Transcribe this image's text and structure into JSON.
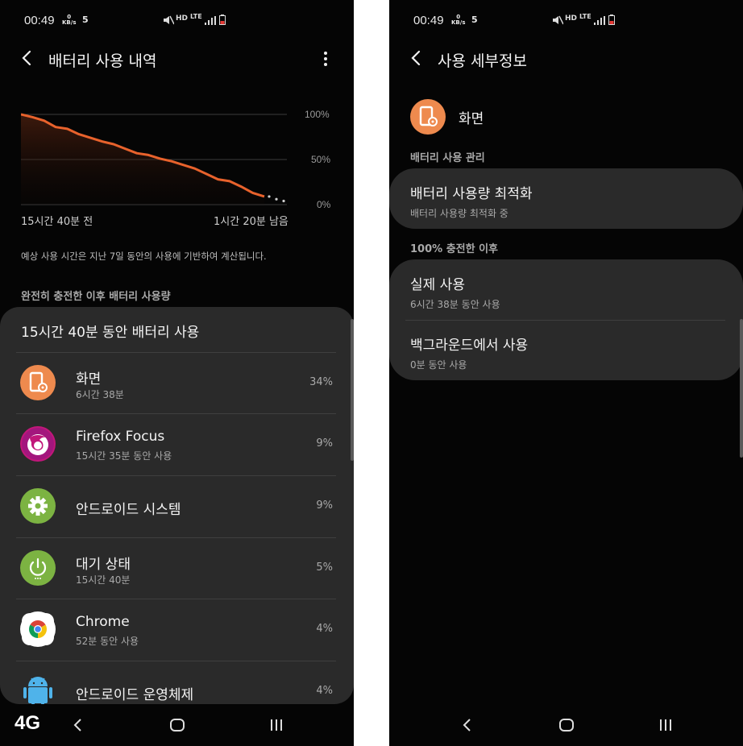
{
  "left": {
    "status": {
      "time": "00:49",
      "kbs_value": "0",
      "kbs_unit": "KB/s",
      "notif_count": "5",
      "hd": "HD",
      "lte": "LTE"
    },
    "title": "배터리 사용 내역",
    "chart_data": {
      "type": "area",
      "y_ticks": [
        "100%",
        "50%",
        "0%"
      ],
      "x_labels": [
        "15시간 40분 전",
        "1시간 20분 남음"
      ],
      "ylim": [
        0,
        100
      ],
      "series": [
        {
          "values": [
            100,
            97,
            93,
            86,
            84,
            78,
            74,
            70,
            67,
            62,
            57,
            55,
            51,
            48,
            44,
            40,
            34,
            28,
            26,
            20,
            13,
            9
          ]
        }
      ],
      "projection": [
        9,
        6,
        4
      ]
    },
    "note": "예상 사용 시간은 지난 7일 동안의 사용에 기반하여 계산됩니다.",
    "section": "완전히 충전한 이후 배터리 사용량",
    "card_title": "15시간 40분 동안 배터리 사용",
    "apps": [
      {
        "name": "화면",
        "sub": "6시간 38분",
        "pct": "34%",
        "icon": "screen-icon"
      },
      {
        "name": "Firefox Focus",
        "sub": "15시간 35분 동안 사용",
        "pct": "9%",
        "icon": "firefox-focus-icon"
      },
      {
        "name": "안드로이드 시스템",
        "sub": "",
        "pct": "9%",
        "icon": "gear-icon"
      },
      {
        "name": "대기 상태",
        "sub": "15시간 40분",
        "pct": "5%",
        "icon": "power-icon"
      },
      {
        "name": "Chrome",
        "sub": "52분 동안 사용",
        "pct": "4%",
        "icon": "chrome-icon"
      },
      {
        "name": "안드로이드 운영체제",
        "sub": "",
        "pct": "4%",
        "icon": "android-icon"
      }
    ],
    "nav": {
      "network": "4G"
    }
  },
  "right": {
    "status": {
      "time": "00:49",
      "kbs_value": "0",
      "kbs_unit": "KB/s",
      "notif_count": "5",
      "hd": "HD",
      "lte": "LTE"
    },
    "title": "사용 세부정보",
    "app_name": "화면",
    "section1": "배터리 사용 관리",
    "optimize_title": "배터리 사용량 최적화",
    "optimize_sub": "배터리 사용량 최적화 중",
    "section2": "100% 충전한 이후",
    "actual_title": "실제 사용",
    "actual_sub": "6시간 38분 동안 사용",
    "bg_title": "백그라운드에서 사용",
    "bg_sub": "0분 동안 사용"
  },
  "colors": {
    "accent": "#e8622c",
    "screen_icon": "#ee8a4e",
    "android_green": "#7cb342",
    "card": "#2a2a2a",
    "background": "#050505"
  }
}
